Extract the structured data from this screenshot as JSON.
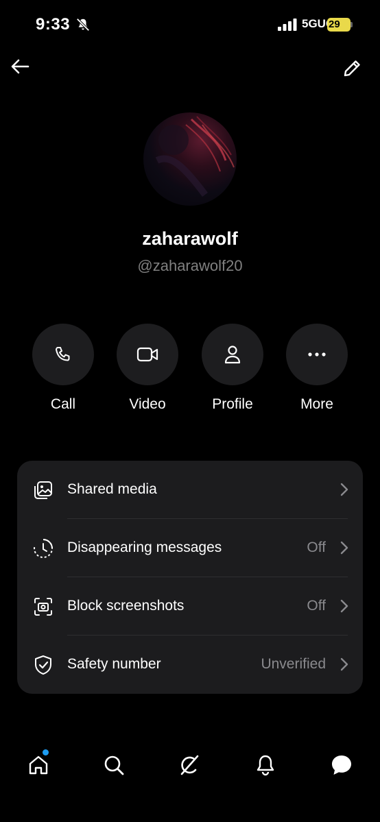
{
  "status_bar": {
    "time": "9:33",
    "network": "5GUC",
    "battery": "29"
  },
  "profile": {
    "name": "zaharawolf",
    "handle": "@zaharawolf20"
  },
  "actions": [
    {
      "label": "Call",
      "icon": "phone-icon"
    },
    {
      "label": "Video",
      "icon": "video-icon"
    },
    {
      "label": "Profile",
      "icon": "person-icon"
    },
    {
      "label": "More",
      "icon": "more-icon"
    }
  ],
  "settings": [
    {
      "label": "Shared media",
      "value": "",
      "icon": "gallery-icon"
    },
    {
      "label": "Disappearing messages",
      "value": "Off",
      "icon": "timer-icon"
    },
    {
      "label": "Block screenshots",
      "value": "Off",
      "icon": "screenshot-icon"
    },
    {
      "label": "Safety number",
      "value": "Unverified",
      "icon": "shield-check-icon"
    }
  ],
  "nav": {
    "items": [
      "home-icon",
      "search-icon",
      "grok-icon",
      "notifications-icon",
      "messages-icon"
    ],
    "home_has_badge": true
  },
  "colors": {
    "background": "#000000",
    "card": "#1c1c1e",
    "muted_text": "#8a8a8e",
    "accent_dot": "#1d9bf0",
    "battery": "#e9d94a"
  }
}
